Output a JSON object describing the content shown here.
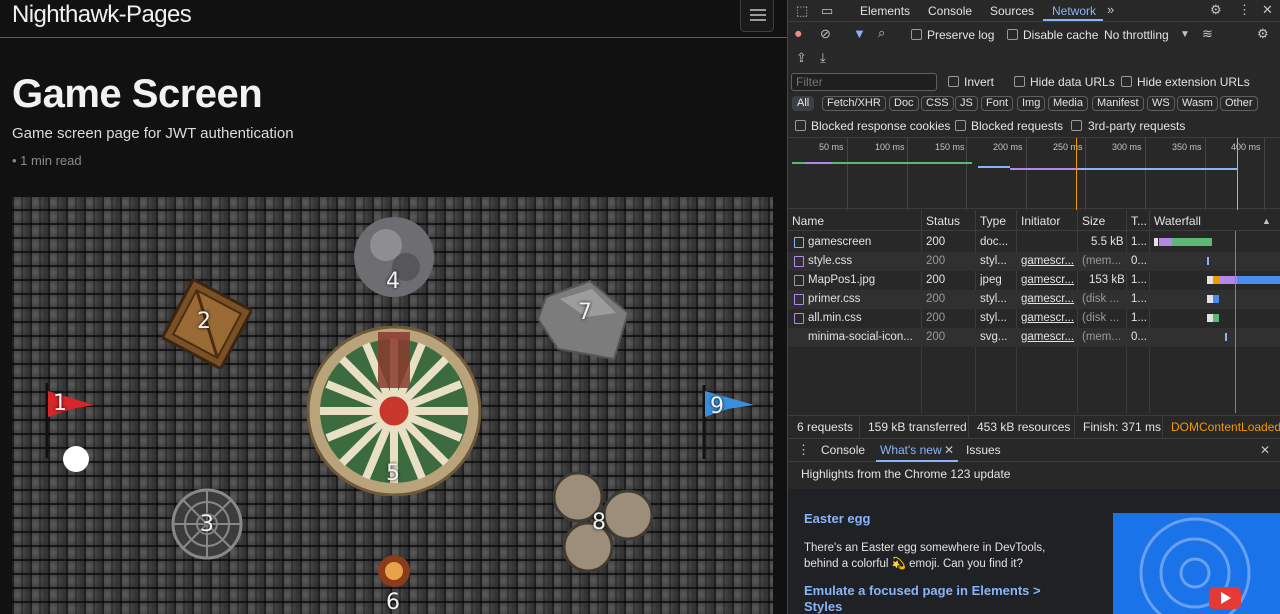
{
  "site": {
    "title": "Nighthawk-Pages",
    "menu_icon": "hamburger-icon"
  },
  "post": {
    "title": "Game Screen",
    "subtitle": "Game screen page for JWT authentication",
    "meta": "• 1 min read"
  },
  "game_map": {
    "markers": [
      "1",
      "2",
      "3",
      "4",
      "5",
      "6",
      "7",
      "8",
      "9"
    ]
  },
  "devtools": {
    "tabs": [
      "Elements",
      "Console",
      "Sources",
      "Network"
    ],
    "active_tab": "Network",
    "more_tabs": "»",
    "toolbar": {
      "preserve_log": "Preserve log",
      "disable_cache": "Disable cache",
      "throttling": "No throttling"
    },
    "filter": {
      "placeholder": "Filter",
      "invert": "Invert",
      "hide_data_urls": "Hide data URLs",
      "hide_extension_urls": "Hide extension URLs"
    },
    "type_filters": [
      "All",
      "Fetch/XHR",
      "Doc",
      "CSS",
      "JS",
      "Font",
      "Img",
      "Media",
      "Manifest",
      "WS",
      "Wasm",
      "Other"
    ],
    "blocked": {
      "cookies": "Blocked response cookies",
      "requests": "Blocked requests",
      "third_party": "3rd-party requests"
    },
    "overview_ticks": [
      "50 ms",
      "100 ms",
      "150 ms",
      "200 ms",
      "250 ms",
      "300 ms",
      "350 ms",
      "400 ms"
    ],
    "columns": {
      "name": "Name",
      "status": "Status",
      "type": "Type",
      "initiator": "Initiator",
      "size": "Size",
      "time": "T...",
      "waterfall": "Waterfall"
    },
    "requests": [
      {
        "name": "gamescreen",
        "status": "200",
        "type": "doc...",
        "initiator": "",
        "size": "5.5 kB",
        "time": "1..."
      },
      {
        "name": "style.css",
        "status": "200",
        "type": "styl...",
        "initiator": "gamescr...",
        "size": "(mem...",
        "time": "0..."
      },
      {
        "name": "MapPos1.jpg",
        "status": "200",
        "type": "jpeg",
        "initiator": "gamescr...",
        "size": "153 kB",
        "time": "1..."
      },
      {
        "name": "primer.css",
        "status": "200",
        "type": "styl...",
        "initiator": "gamescr...",
        "size": "(disk ...",
        "time": "1..."
      },
      {
        "name": "all.min.css",
        "status": "200",
        "type": "styl...",
        "initiator": "gamescr...",
        "size": "(disk ...",
        "time": "1..."
      },
      {
        "name": "minima-social-icon...",
        "status": "200",
        "type": "svg...",
        "initiator": "gamescr...",
        "size": "(mem...",
        "time": "0..."
      }
    ],
    "summary": {
      "requests": "6 requests",
      "transferred": "159 kB transferred",
      "resources": "453 kB resources",
      "finish": "Finish: 371 ms",
      "dcl": "DOMContentLoaded:"
    },
    "drawer": {
      "tabs": [
        "Console",
        "What's new",
        "Issues"
      ],
      "active_tab": "What's new",
      "highlights": "Highlights from the Chrome 123 update",
      "items": [
        {
          "title": "Easter egg",
          "text_line1": "There's an Easter egg somewhere in DevTools,",
          "text_line2": "behind a colorful 💫 emoji. Can you find it?"
        },
        {
          "title_line1": "Emulate a focused page in Elements >",
          "title_line2": "Styles"
        }
      ]
    },
    "colors": {
      "accent": "#8ab4f8",
      "record": "#f28b82",
      "dcl": "#f29900"
    }
  }
}
